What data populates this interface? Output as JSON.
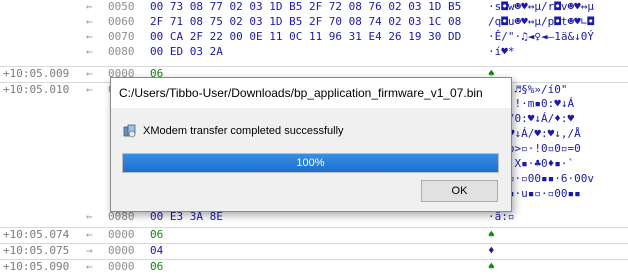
{
  "log": {
    "rows": [
      {
        "ts": "",
        "arrow": "←",
        "offset": "0050",
        "hex": "00 73 08 77 02 03 1D B5 2F 72 08 76 02 03 1D B5",
        "ascii": "·s◘w☻♥↔µ/r◘v☻♥↔µ"
      },
      {
        "ts": "",
        "arrow": "←",
        "offset": "0060",
        "hex": "2F 71 08 75 02 03 1D B5 2F 70 08 74 02 03 1C 08",
        "ascii": "/q◘u☻♥↔µ/p◘t☻♥∟◘"
      },
      {
        "ts": "",
        "arrow": "←",
        "offset": "0070",
        "hex": "00 CA 2F 22 00 0E 11 0C 11 96 31 E4 26 19 30 DD",
        "ascii": "·Ê/\"·♫◄♀◄–1ä&↓0Ý"
      },
      {
        "ts": "",
        "arrow": "←",
        "offset": "0080",
        "hex": "00 ED 03 2A",
        "ascii": "·í♥*"
      },
      {
        "ts": "+10:05.009",
        "arrow": "←",
        "offset": "0000",
        "hex": "06",
        "ascii": "♠"
      },
      {
        "ts": "+10:05.010",
        "arrow": "←",
        "offset": "0000",
        "hex": "",
        "ascii": "▪·\"·♬§%»/í0\""
      },
      {
        "ts": "",
        "arrow": "",
        "offset": "",
        "hex": "",
        "ascii": "§%▪·!·m▪0:♥↓Á"
      },
      {
        "ts": "",
        "arrow": "",
        "offset": "",
        "hex": "",
        "ascii": "♥↓,/0:♥↓Á/♦:♥"
      },
      {
        "ts": "",
        "arrow": "",
        "offset": "",
        "hex": "",
        "ascii": "/0:♥↓Á/♥:♥↓,/Å"
      },
      {
        "ts": "",
        "arrow": "",
        "offset": "",
        "hex": "",
        "ascii": "┼f▪ò>▫·!0▫0▫=0"
      },
      {
        "ts": "",
        "arrow": "",
        "offset": "",
        "hex": "",
        "ascii": "▪·!·X▪·♣0♦▪·`"
      },
      {
        "ts": "",
        "arrow": "",
        "offset": "",
        "hex": "",
        "ascii": "▪s·▫·▫00▪▪·6·00v"
      },
      {
        "ts": "",
        "arrow": "",
        "offset": "",
        "hex": "",
        "ascii": "▪s♠▪·u▪▫·▫00▪▪"
      },
      {
        "ts": "",
        "arrow": "←",
        "offset": "0080",
        "hex": "00 E3 3A 8E",
        "ascii": "·ã:▫"
      },
      {
        "ts": "+10:05.074",
        "arrow": "←",
        "offset": "0000",
        "hex": "06",
        "ascii": "♠"
      },
      {
        "ts": "+10:05.075",
        "arrow": "→",
        "offset": "0000",
        "hex": "04",
        "ascii": "♦"
      },
      {
        "ts": "+10:05.090",
        "arrow": "←",
        "offset": "0000",
        "hex": "06",
        "ascii": "♠"
      }
    ]
  },
  "dialog": {
    "title": "C:/Users/Tibbo-User/Downloads/bp_application_firmware_v1_07.bin",
    "message": "XModem transfer completed successfully",
    "progress_percent": 100,
    "progress_label": "100%",
    "ok_label": "OK",
    "icon": "transfer-icon"
  },
  "colors": {
    "progress": "#1a6fd0",
    "hex_data": "#1a1aa8",
    "ack": "#0b8a0b"
  }
}
